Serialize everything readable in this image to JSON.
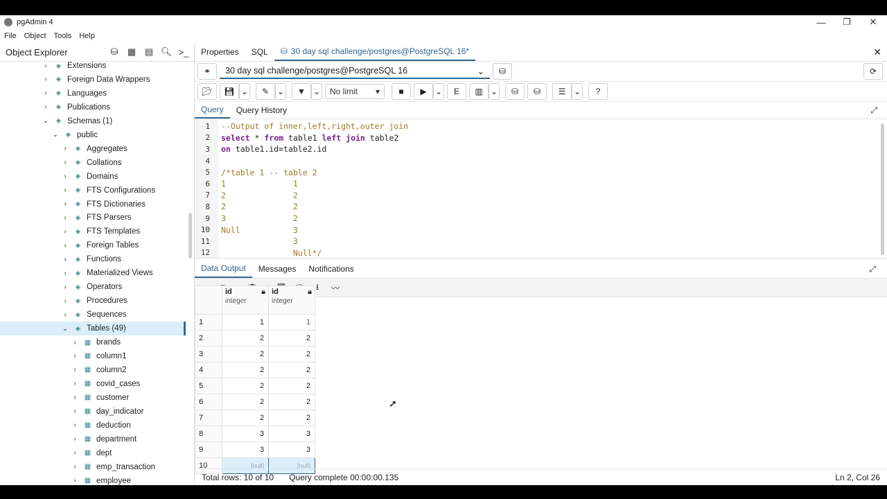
{
  "window": {
    "title": "pgAdmin 4",
    "controls": [
      "—",
      "❐",
      "✕"
    ]
  },
  "menu": [
    "File",
    "Object",
    "Tools",
    "Help"
  ],
  "object_explorer": {
    "title": "Object Explorer",
    "items": [
      {
        "label": "Extensions",
        "indent": 0,
        "icon": "extensions-icon",
        "expanded": false
      },
      {
        "label": "Foreign Data Wrappers",
        "indent": 0,
        "icon": "fdw-icon",
        "expanded": false
      },
      {
        "label": "Languages",
        "indent": 0,
        "icon": "languages-icon",
        "expanded": false
      },
      {
        "label": "Publications",
        "indent": 0,
        "icon": "publications-icon",
        "expanded": false
      },
      {
        "label": "Schemas (1)",
        "indent": 0,
        "icon": "schemas-icon",
        "expanded": true
      },
      {
        "label": "public",
        "indent": 1,
        "icon": "schema-icon",
        "expanded": true
      },
      {
        "label": "Aggregates",
        "indent": 2,
        "icon": "aggregates-icon",
        "expanded": false
      },
      {
        "label": "Collations",
        "indent": 2,
        "icon": "collations-icon",
        "expanded": false
      },
      {
        "label": "Domains",
        "indent": 2,
        "icon": "domains-icon",
        "expanded": false
      },
      {
        "label": "FTS Configurations",
        "indent": 2,
        "icon": "fts-config-icon",
        "expanded": false
      },
      {
        "label": "FTS Dictionaries",
        "indent": 2,
        "icon": "fts-dict-icon",
        "expanded": false
      },
      {
        "label": "FTS Parsers",
        "indent": 2,
        "icon": "fts-parsers-icon",
        "expanded": false
      },
      {
        "label": "FTS Templates",
        "indent": 2,
        "icon": "fts-templates-icon",
        "expanded": false
      },
      {
        "label": "Foreign Tables",
        "indent": 2,
        "icon": "foreign-tables-icon",
        "expanded": false
      },
      {
        "label": "Functions",
        "indent": 2,
        "icon": "functions-icon",
        "expanded": false
      },
      {
        "label": "Materialized Views",
        "indent": 2,
        "icon": "mat-views-icon",
        "expanded": false
      },
      {
        "label": "Operators",
        "indent": 2,
        "icon": "operators-icon",
        "expanded": false
      },
      {
        "label": "Procedures",
        "indent": 2,
        "icon": "procedures-icon",
        "expanded": false
      },
      {
        "label": "Sequences",
        "indent": 2,
        "icon": "sequences-icon",
        "expanded": false
      },
      {
        "label": "Tables (49)",
        "indent": 2,
        "icon": "tables-icon",
        "expanded": true,
        "selected": true
      },
      {
        "label": "brands",
        "indent": 3,
        "icon": "table-icon",
        "expanded": false
      },
      {
        "label": "column1",
        "indent": 3,
        "icon": "table-icon",
        "expanded": false
      },
      {
        "label": "column2",
        "indent": 3,
        "icon": "table-icon",
        "expanded": false
      },
      {
        "label": "covid_cases",
        "indent": 3,
        "icon": "table-icon",
        "expanded": false
      },
      {
        "label": "customer",
        "indent": 3,
        "icon": "table-icon",
        "expanded": false
      },
      {
        "label": "day_indicator",
        "indent": 3,
        "icon": "table-icon",
        "expanded": false
      },
      {
        "label": "deduction",
        "indent": 3,
        "icon": "table-icon",
        "expanded": false
      },
      {
        "label": "department",
        "indent": 3,
        "icon": "table-icon",
        "expanded": false
      },
      {
        "label": "dept",
        "indent": 3,
        "icon": "table-icon",
        "expanded": false
      },
      {
        "label": "emp_transaction",
        "indent": 3,
        "icon": "table-icon",
        "expanded": false
      },
      {
        "label": "employee",
        "indent": 3,
        "icon": "table-icon",
        "expanded": false
      }
    ]
  },
  "main_tabs": [
    {
      "label": "Properties",
      "active": false
    },
    {
      "label": "SQL",
      "active": false
    },
    {
      "label": "30 day sql challenge/postgres@PostgreSQL 16*",
      "active": true
    }
  ],
  "connection": {
    "value": "30 day sql challenge/postgres@PostgreSQL 16"
  },
  "toolbar": {
    "limit": "No limit"
  },
  "editor_tabs": [
    {
      "label": "Query",
      "active": true
    },
    {
      "label": "Query History",
      "active": false
    }
  ],
  "editor_lines": [
    "--Output of inner,left,right,outer join",
    "select * from table1 left join table2",
    "on table1.id=table2.id",
    "",
    "/*table 1 -- table 2",
    "1              1",
    "2              2",
    "2              2",
    "3              2",
    "Null           3",
    "               3",
    "               Null*/"
  ],
  "output_tabs": [
    {
      "label": "Data Output",
      "active": true
    },
    {
      "label": "Messages",
      "active": false
    },
    {
      "label": "Notifications",
      "active": false
    }
  ],
  "result": {
    "columns": [
      {
        "name": "id",
        "type": "integer"
      },
      {
        "name": "id",
        "type": "integer"
      }
    ],
    "rows": [
      [
        "1",
        "1"
      ],
      [
        "2",
        "2"
      ],
      [
        "2",
        "2"
      ],
      [
        "2",
        "2"
      ],
      [
        "2",
        "2"
      ],
      [
        "2",
        "2"
      ],
      [
        "2",
        "2"
      ],
      [
        "3",
        "3"
      ],
      [
        "3",
        "3"
      ],
      [
        "[null]",
        "[null]"
      ]
    ]
  },
  "status": {
    "total_rows": "Total rows: 10 of 10",
    "query_complete": "Query complete 00:00:00.135",
    "cursor_pos": "Ln 2, Col 26"
  }
}
